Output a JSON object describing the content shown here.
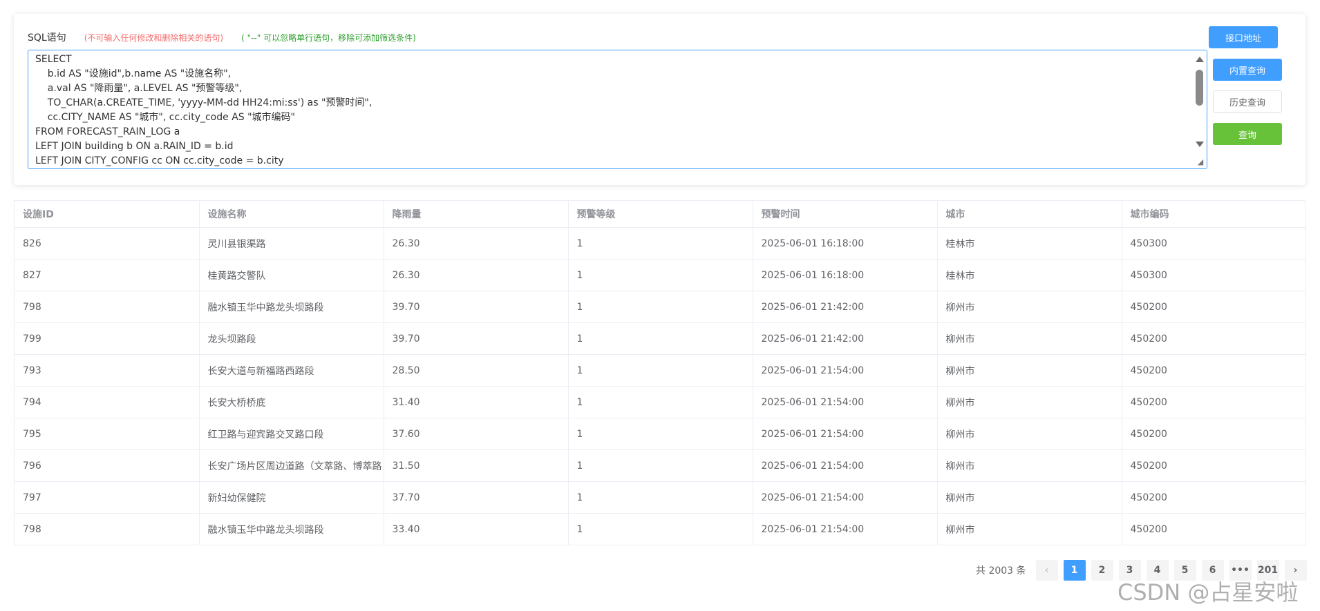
{
  "sql_panel": {
    "label": "SQL语句",
    "warning": "(不可输入任何修改和删除相关的语句)",
    "hint": "( \"--\" 可以忽略单行语句，移除可添加筛选条件)",
    "code_lines": [
      "SELECT",
      "    b.id AS \"设施id\",b.name AS \"设施名称\",",
      "    a.val AS \"降雨量\", a.LEVEL AS \"预警等级\",",
      "    TO_CHAR(a.CREATE_TIME, 'yyyy-MM-dd HH24:mi:ss') as \"预警时间\",",
      "    cc.CITY_NAME AS \"城市\", cc.city_code AS \"城市编码\"",
      "FROM FORECAST_RAIN_LOG a",
      "LEFT JOIN building b ON a.RAIN_ID = b.id",
      "LEFT JOIN CITY_CONFIG cc ON cc.city_code = b.city"
    ]
  },
  "buttons": {
    "api": "接口地址",
    "builtin_query": "内置查询",
    "history_query": "历史查询",
    "query": "查询"
  },
  "table": {
    "columns": [
      "设施ID",
      "设施名称",
      "降雨量",
      "预警等级",
      "预警时间",
      "城市",
      "城市编码"
    ],
    "rows": [
      [
        "826",
        "灵川县银渠路",
        "26.30",
        "1",
        "2025-06-01 16:18:00",
        "桂林市",
        "450300"
      ],
      [
        "827",
        "桂黄路交警队",
        "26.30",
        "1",
        "2025-06-01 16:18:00",
        "桂林市",
        "450300"
      ],
      [
        "798",
        "融水镇玉华中路龙头坝路段",
        "39.70",
        "1",
        "2025-06-01 21:42:00",
        "柳州市",
        "450200"
      ],
      [
        "799",
        "龙头坝路段",
        "39.70",
        "1",
        "2025-06-01 21:42:00",
        "柳州市",
        "450200"
      ],
      [
        "793",
        "长安大道与新福路西路段",
        "28.50",
        "1",
        "2025-06-01 21:54:00",
        "柳州市",
        "450200"
      ],
      [
        "794",
        "长安大桥桥底",
        "31.40",
        "1",
        "2025-06-01 21:54:00",
        "柳州市",
        "450200"
      ],
      [
        "795",
        "红卫路与迎宾路交叉路口段",
        "37.60",
        "1",
        "2025-06-01 21:54:00",
        "柳州市",
        "450200"
      ],
      [
        "796",
        "长安广场片区周边道路（文萃路、博萃路",
        "31.50",
        "1",
        "2025-06-01 21:54:00",
        "柳州市",
        "450200"
      ],
      [
        "797",
        "新妇幼保健院",
        "37.70",
        "1",
        "2025-06-01 21:54:00",
        "柳州市",
        "450200"
      ],
      [
        "798",
        "融水镇玉华中路龙头坝路段",
        "33.40",
        "1",
        "2025-06-01 21:54:00",
        "柳州市",
        "450200"
      ]
    ]
  },
  "pagination": {
    "total_text": "共 2003 条",
    "prev_icon": "‹",
    "pages": [
      "1",
      "2",
      "3",
      "4",
      "5",
      "6",
      "•••",
      "201"
    ],
    "active_page": "1",
    "next_icon": "›"
  },
  "watermark": "CSDN @占星安啦",
  "colors": {
    "primary": "#409eff",
    "success": "#67c23a",
    "warning_text": "#f56c6c",
    "hint_text": "#2e9e2e"
  }
}
